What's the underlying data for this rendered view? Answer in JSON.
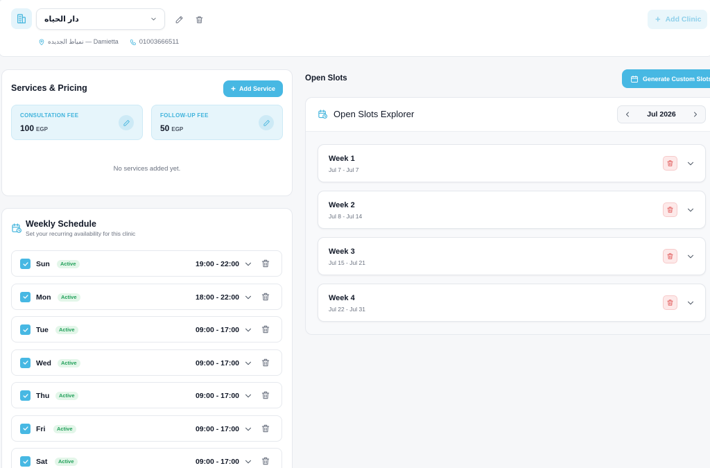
{
  "clinic": {
    "selected_name": "دار الحياه",
    "address": "نمياط الجديده — Damietta",
    "phone": "01003666511",
    "add_label": "Add Clinic"
  },
  "services": {
    "title": "Services & Pricing",
    "add_label": "Add Service",
    "consultation": {
      "label": "CONSULTATION FEE",
      "amount": "100",
      "currency": "EGP"
    },
    "followup": {
      "label": "FOLLOW-UP FEE",
      "amount": "50",
      "currency": "EGP"
    },
    "empty_text": "No services added yet."
  },
  "schedule": {
    "title": "Weekly Schedule",
    "subtitle": "Set your recurring availability for this clinic",
    "days": [
      {
        "name": "Sun",
        "status": "Active",
        "hours": "19:00 - 22:00",
        "checked": true
      },
      {
        "name": "Mon",
        "status": "Active",
        "hours": "18:00 - 22:00",
        "checked": true
      },
      {
        "name": "Tue",
        "status": "Active",
        "hours": "09:00 - 17:00",
        "checked": true
      },
      {
        "name": "Wed",
        "status": "Active",
        "hours": "09:00 - 17:00",
        "checked": true
      },
      {
        "name": "Thu",
        "status": "Active",
        "hours": "09:00 - 17:00",
        "checked": true
      },
      {
        "name": "Fri",
        "status": "Active",
        "hours": "09:00 - 17:00",
        "checked": true
      },
      {
        "name": "Sat",
        "status": "Active",
        "hours": "09:00 - 17:00",
        "checked": true
      }
    ]
  },
  "slots": {
    "title": "Open Slots",
    "generate_label": "Generate Custom Slots",
    "explorer_title": "Open Slots Explorer",
    "month": "Jul 2026",
    "weeks": [
      {
        "name": "Week 1",
        "range": "Jul 7 - Jul 7"
      },
      {
        "name": "Week 2",
        "range": "Jul 8 - Jul 14"
      },
      {
        "name": "Week 3",
        "range": "Jul 15 - Jul 21"
      },
      {
        "name": "Week 4",
        "range": "Jul 22 - Jul 31"
      }
    ]
  },
  "colors": {
    "accent": "#47b8e3",
    "accent_light": "#e6f5fb",
    "active_badge": "#22a05a",
    "danger": "#e05757"
  },
  "icons": {
    "clinic_logo": "building-icon",
    "location": "map-pin-icon",
    "phone": "phone-icon",
    "edit": "pencil-icon",
    "delete": "trash-icon",
    "calendar": "calendar-clock-icon",
    "prev": "chevron-left-icon",
    "next": "chevron-right-icon",
    "expand": "chevron-down-icon"
  }
}
